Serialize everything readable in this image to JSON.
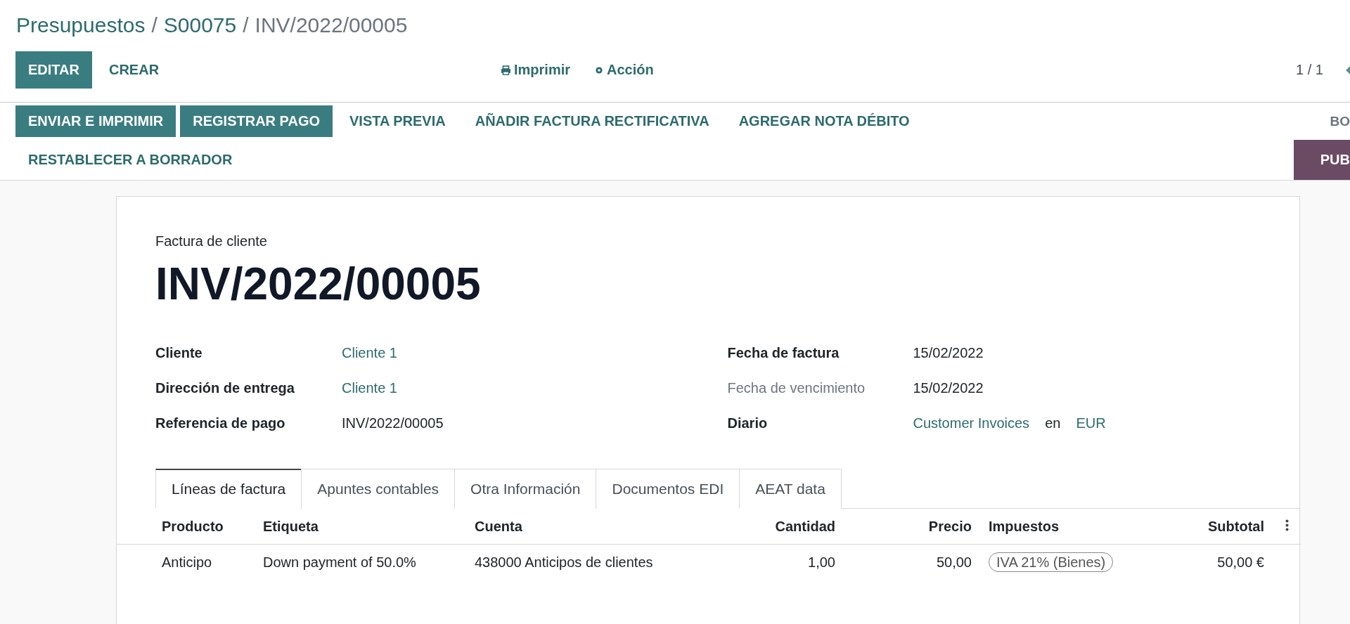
{
  "breadcrumb": [
    {
      "label": "Presupuestos",
      "link": true
    },
    {
      "separator": "/",
      "label": "S00075",
      "link": true
    },
    {
      "separator": "/",
      "label": "INV/2022/00005",
      "link": false
    }
  ],
  "control_panel": {
    "buttons": [
      {
        "label": "EDITAR",
        "kind": "primary"
      },
      {
        "label": "CREAR",
        "kind": "link"
      }
    ],
    "print": "Imprimir",
    "action": "Acción",
    "pager": "1 / 1"
  },
  "action_rows": [
    {
      "buttons": [
        {
          "label": "ENVIAR E IMPRIMIR",
          "kind": "primary"
        },
        {
          "label": "REGISTRAR PAGO",
          "kind": "primary"
        },
        {
          "label": "VISTA PREVIA",
          "kind": "link"
        },
        {
          "label": "AÑADIR FACTURA RECTIFICATIVA",
          "kind": "link"
        },
        {
          "label": "AGREGAR NOTA DÉBITO",
          "kind": "link"
        }
      ],
      "right": {
        "label": "BO",
        "kind": "status"
      }
    },
    {
      "buttons": [
        {
          "label": "RESTABLECER A BORRADOR",
          "kind": "link"
        }
      ],
      "right": {
        "label": "PUB",
        "kind": "publish"
      }
    }
  ],
  "sheet": {
    "subtitle": "Factura de cliente",
    "title": "INV/2022/00005",
    "left_fields": [
      {
        "label": "Cliente",
        "muted": false,
        "value": [
          {
            "text": "Cliente 1",
            "link": true
          }
        ]
      },
      {
        "label": "Dirección de entrega",
        "muted": false,
        "value": [
          {
            "text": "Cliente 1",
            "link": true
          }
        ]
      },
      {
        "label": "Referencia de pago",
        "muted": false,
        "value": [
          {
            "text": "INV/2022/00005",
            "link": false
          }
        ]
      }
    ],
    "right_fields": [
      {
        "label": "Fecha de factura",
        "muted": false,
        "value": [
          {
            "text": "15/02/2022",
            "link": false
          }
        ]
      },
      {
        "label": "Fecha de vencimiento",
        "muted": true,
        "value": [
          {
            "text": "15/02/2022",
            "link": false
          }
        ]
      },
      {
        "label": "Diario",
        "muted": false,
        "value": [
          {
            "text": "Customer Invoices",
            "link": true
          },
          {
            "text": "en",
            "link": false
          },
          {
            "text": "EUR",
            "link": true
          }
        ]
      }
    ],
    "tabs": [
      {
        "label": "Líneas de factura",
        "selected": true
      },
      {
        "label": "Apuntes contables",
        "selected": false
      },
      {
        "label": "Otra Información",
        "selected": false
      },
      {
        "label": "Documentos EDI",
        "selected": false
      },
      {
        "label": "AEAT data",
        "selected": false
      }
    ],
    "table": {
      "columns": [
        {
          "label": "Producto",
          "kind": "text"
        },
        {
          "label": "Etiqueta",
          "kind": "text"
        },
        {
          "label": "Cuenta",
          "kind": "text"
        },
        {
          "label": "Cantidad",
          "kind": "number"
        },
        {
          "label": "Precio",
          "kind": "number"
        },
        {
          "label": "Impuestos",
          "kind": "text"
        },
        {
          "label": "Subtotal",
          "kind": "number"
        }
      ],
      "rows": [
        {
          "cells": [
            {
              "text": "Anticipo",
              "kind": "text"
            },
            {
              "text": "Down payment of 50.0%",
              "kind": "text"
            },
            {
              "text": "438000 Anticipos de clientes",
              "kind": "text"
            },
            {
              "text": "1,00",
              "kind": "text"
            },
            {
              "text": "50,00",
              "kind": "text"
            },
            {
              "text": "IVA 21% (Bienes)",
              "kind": "tag"
            },
            {
              "text": "50,00 €",
              "kind": "text"
            }
          ]
        }
      ]
    }
  }
}
